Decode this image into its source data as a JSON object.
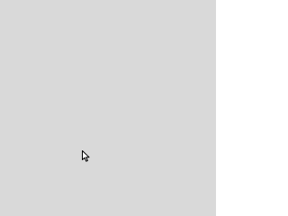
{
  "screen": {
    "background_color": "#d9d9d9"
  },
  "cursor": {
    "icon": "arrow-pointer-icon",
    "fill_color": "#ffffff",
    "stroke_color": "#000000"
  }
}
